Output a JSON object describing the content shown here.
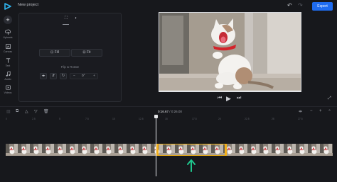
{
  "header": {
    "project_title": "New project",
    "undo_icon": "undo-icon",
    "redo_icon": "redo-icon",
    "export_label": "Export",
    "accent": "#1f6cf0"
  },
  "sidebar": {
    "items": [
      {
        "label": "Uploads",
        "icon": "upload-icon"
      },
      {
        "label": "Canvas",
        "icon": "canvas-icon"
      },
      {
        "label": "Text",
        "icon": "text-icon"
      },
      {
        "label": "Audio",
        "icon": "music-note-icon"
      },
      {
        "label": "Videos",
        "icon": "video-icon"
      }
    ]
  },
  "panel": {
    "tabs": [
      "crop-icon",
      "color-adjust-icon"
    ],
    "fill_label": "Fill",
    "fit_label": "Fit",
    "flip_rotate_label": "Flip & Rotate",
    "rotate_value": "0°"
  },
  "player": {
    "controls": [
      "skip-back-icon",
      "play-icon",
      "skip-forward-icon"
    ]
  },
  "timeline": {
    "current_time": "0:16.67",
    "total_time": "0:26.00",
    "separator": "/",
    "ruler_labels": [
      "0",
      "2.5",
      "5",
      "7.5",
      "10",
      "12.5",
      "15",
      "17.5",
      "20",
      "22.5",
      "25",
      "27.5"
    ],
    "selection_color": "#f0b21a",
    "arrow_color": "#1fc58c"
  }
}
